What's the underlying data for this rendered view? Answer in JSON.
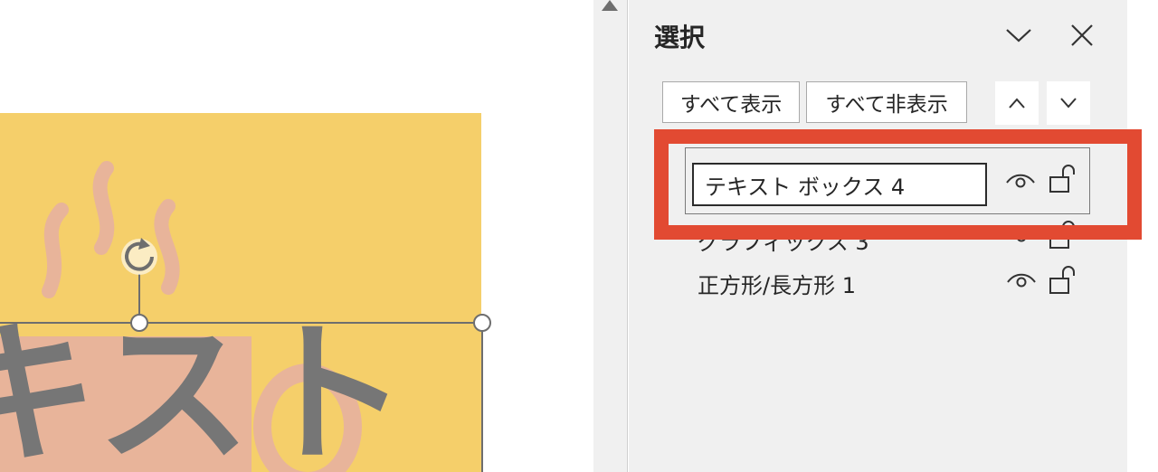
{
  "slide": {
    "big_text": "キスト"
  },
  "selection_pane": {
    "title": "選択",
    "menu_icon": "chevron-down-icon",
    "close_icon": "close-icon",
    "buttons": {
      "show_all": "すべて表示",
      "hide_all": "すべて非表示",
      "move_up_icon": "chevron-up-icon",
      "move_down_icon": "chevron-down-icon"
    },
    "items": [
      {
        "name": "テキスト ボックス 4",
        "visible": true,
        "locked": false,
        "editing": true
      },
      {
        "name": "グラフィックス 3",
        "visible": true,
        "locked": false,
        "editing": false
      },
      {
        "name": "正方形/長方形 1",
        "visible": true,
        "locked": false,
        "editing": false
      }
    ]
  },
  "colors": {
    "slide_background": "#f5cf6a",
    "cup": "#e8b49a",
    "text": "#767676",
    "highlight": "#e24a32",
    "pane_background": "#f0f0f0"
  }
}
